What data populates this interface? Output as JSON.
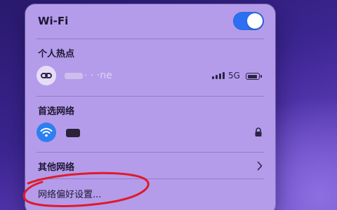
{
  "wifi": {
    "title": "Wi-Fi",
    "enabled": true,
    "toggle_color": "#2d6ff2"
  },
  "hotspot": {
    "section_label": "个人热点",
    "device_name": "iPhone",
    "device_name_visible": "· ·  ·ne",
    "network_type": "5G",
    "signal_bars": 4,
    "battery_level": 0.8,
    "icon": "link-chain-icon"
  },
  "preferred": {
    "section_label": "首选网络",
    "network_name": "",
    "icon": "wifi-icon",
    "secured": true,
    "accent_color": "#2d7ff0"
  },
  "other_networks": {
    "label": "其他网络",
    "icon": "chevron-right-icon"
  },
  "preferences": {
    "label": "网络偏好设置..."
  },
  "annotation_color": "#e01a2a"
}
